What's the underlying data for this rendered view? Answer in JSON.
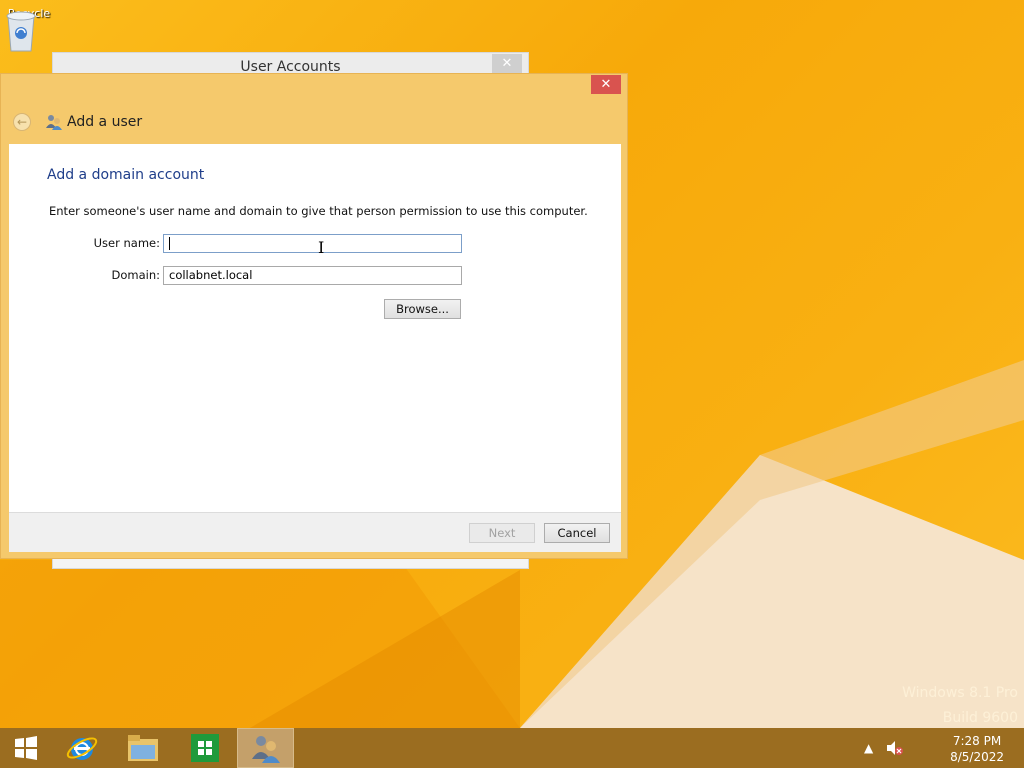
{
  "desktop": {
    "recycle_label": "Recycle",
    "watermark_line1": "Windows 8.1 Pro",
    "watermark_line2": "Build 9600"
  },
  "background_window": {
    "title": "User Accounts",
    "close_glyph": "✕"
  },
  "dialog": {
    "close_glyph": "✕",
    "nav_title": "Add a user",
    "heading": "Add a domain account",
    "description": "Enter someone's user name and domain to give that person permission to use this computer.",
    "username_label": "User name:",
    "username_value": "",
    "domain_label": "Domain:",
    "domain_value": "collabnet.local",
    "browse_label": "Browse...",
    "next_label": "Next",
    "cancel_label": "Cancel"
  },
  "taskbar": {
    "time": "7:28 PM",
    "date": "8/5/2022",
    "icons": [
      "windows-start-icon",
      "internet-explorer-icon",
      "file-explorer-icon",
      "store-icon",
      "user-accounts-icon"
    ]
  },
  "colors": {
    "desktop": "#f7a90a",
    "dialog_frame": "#f5c96c",
    "heading": "#1f3e8a",
    "close_red": "#d9534f",
    "taskbar": "#9b6d20"
  }
}
